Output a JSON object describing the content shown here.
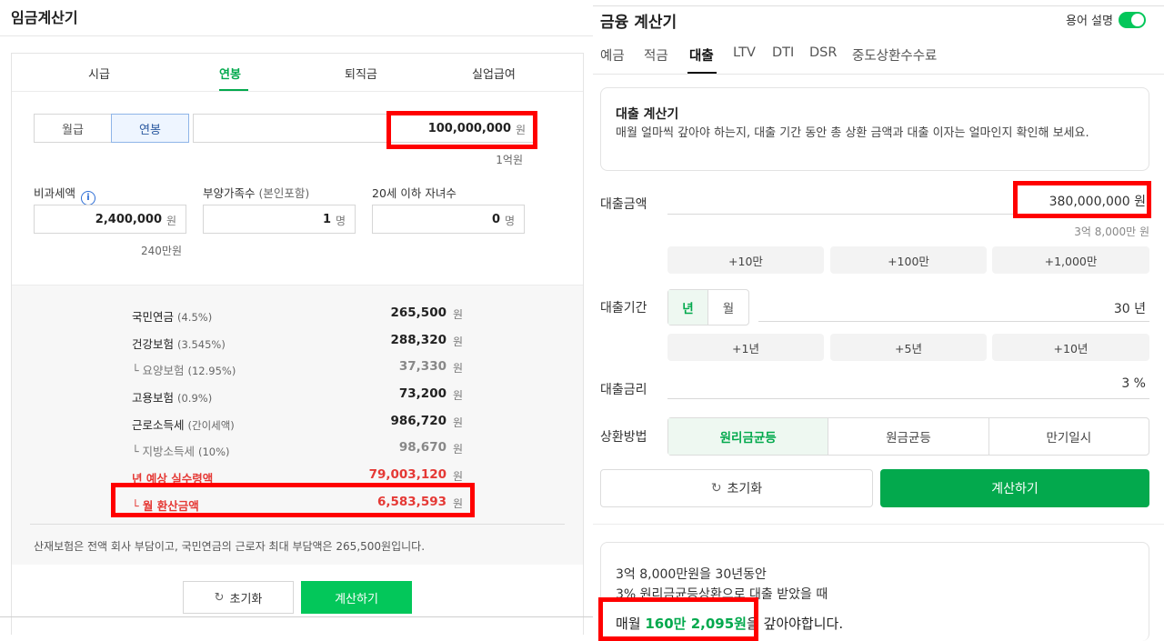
{
  "wage_calc": {
    "title": "임금계산기",
    "tabs": [
      "시급",
      "연봉",
      "퇴직금",
      "실업급여"
    ],
    "active_tab": "연봉",
    "pay_type": [
      "월급",
      "연봉"
    ],
    "salary_value": "100,000,000",
    "salary_unit": "원",
    "salary_hint": "1억원",
    "fields": [
      {
        "label": "비과세액",
        "sub": "",
        "value": "2,400,000",
        "unit": "원"
      },
      {
        "label": "부양가족수",
        "sub": "(본인포함)",
        "value": "1",
        "unit": "명"
      },
      {
        "label": "20세 이하 자녀수",
        "sub": "",
        "value": "0",
        "unit": "명"
      }
    ],
    "nontax_hint": "240만원",
    "results": [
      {
        "label": "국민연금",
        "pct": "(4.5%)",
        "value": "265,500",
        "unit": "원"
      },
      {
        "label": "건강보험",
        "pct": "(3.545%)",
        "value": "288,320",
        "unit": "원"
      },
      {
        "label": "└ 요양보험",
        "pct": "(12.95%)",
        "value": "37,330",
        "unit": "원"
      },
      {
        "label": "고용보험",
        "pct": "(0.9%)",
        "value": "73,200",
        "unit": "원"
      },
      {
        "label": "근로소득세",
        "pct": "(간이세액)",
        "value": "986,720",
        "unit": "원"
      },
      {
        "label": "└ 지방소득세",
        "pct": "(10%)",
        "value": "98,670",
        "unit": "원"
      },
      {
        "label": "년 예상 실수령액",
        "pct": "",
        "value": "79,003,120",
        "unit": "원"
      },
      {
        "label": "└ 월 환산금액",
        "pct": "",
        "value": "6,583,593",
        "unit": "원"
      }
    ],
    "note": "산재보험은 전액 회사 부담이고, 국민연금의 근로자 최대 부담액은 265,500원입니다.",
    "reset_label": "초기화",
    "calc_label": "계산하기"
  },
  "finance_calc": {
    "title": "금융 계산기",
    "term_toggle": "용어 설명",
    "tabs": [
      "예금",
      "적금",
      "대출",
      "LTV",
      "DTI",
      "DSR",
      "중도상환수수료"
    ],
    "active_tab": "대출",
    "intro_title": "대출 계산기",
    "intro_text": "매월 얼마씩 갚아야 하는지, 대출 기간 동안 총 상환 금액과 대출 이자는 얼마인지 확인해 보세요.",
    "loan_label": "대출금액",
    "loan_value": "380,000,000 원",
    "loan_hint": "3억 8,000만 원",
    "loan_chips": [
      "+10만",
      "+100만",
      "+1,000만"
    ],
    "period_label": "대출기간",
    "period_units": [
      "년",
      "월"
    ],
    "period_value": "30 년",
    "period_chips": [
      "+1년",
      "+5년",
      "+10년"
    ],
    "rate_label": "대출금리",
    "rate_value": "3 %",
    "method_label": "상환방법",
    "methods": [
      "원리금균등",
      "원금균등",
      "만기일시"
    ],
    "reset_label": "초기화",
    "calc_label": "계산하기",
    "result_line1": "3억 8,000만원을 30년동안",
    "result_line2": "3% 원리금균등상환으로 대출 받았을 때",
    "result_prefix": "매월 ",
    "result_amount": "160만 2,095원",
    "result_suffix": "을 갚아야합니다."
  },
  "colors": {
    "accent_green": "#03c75a",
    "highlight_red": "#ff0000",
    "warn_red": "#e53935"
  }
}
